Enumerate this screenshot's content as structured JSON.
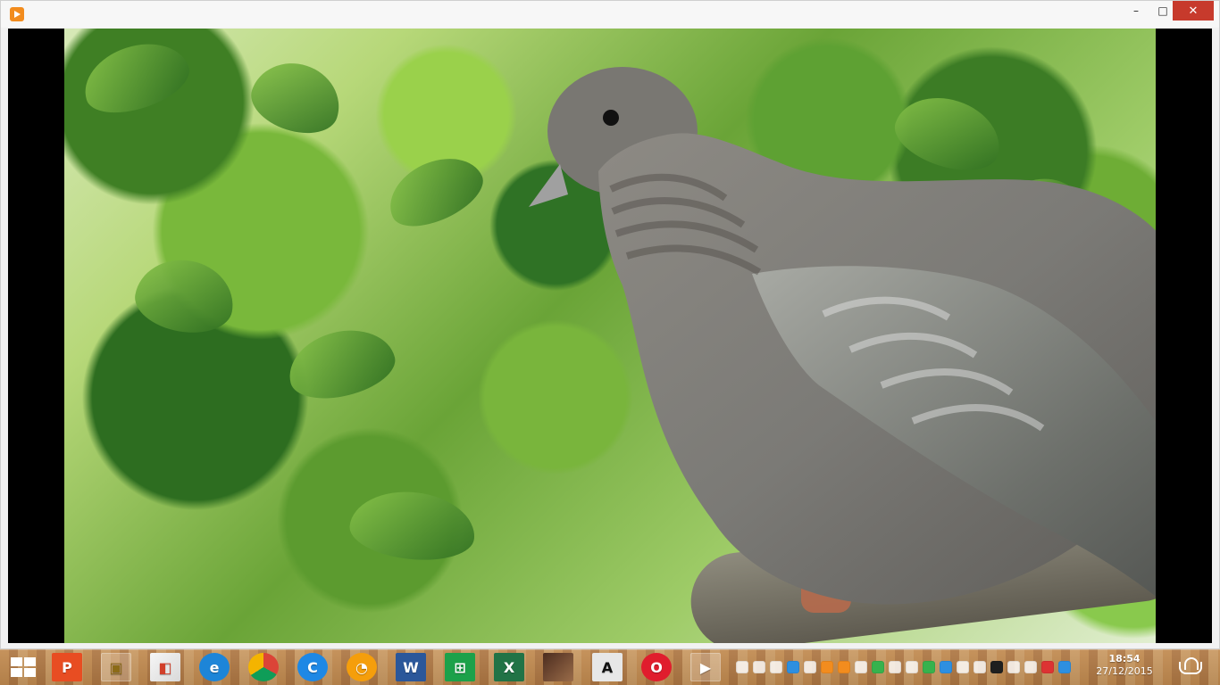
{
  "window": {
    "app_icon": "media-player-icon",
    "buttons": {
      "minimize": "–",
      "maximize": "□",
      "close": "✕"
    }
  },
  "video": {
    "subject": "dove-on-branch",
    "colors": {
      "background": "#000000",
      "leaf_green": "#6aa437",
      "bird_gray": "#7b7a76",
      "branch": "#6c675b"
    }
  },
  "taskbar": {
    "apps": [
      {
        "name": "powerpoint-icon",
        "label": "P"
      },
      {
        "name": "folder-icon",
        "label": "▣"
      },
      {
        "name": "paint-icon",
        "label": "◧"
      },
      {
        "name": "internet-explorer-icon",
        "label": "e"
      },
      {
        "name": "chrome-icon",
        "label": ""
      },
      {
        "name": "c-app-icon",
        "label": "C"
      },
      {
        "name": "firefox-icon",
        "label": "◔"
      },
      {
        "name": "word-icon",
        "label": "W"
      },
      {
        "name": "store-icon",
        "label": "⊞"
      },
      {
        "name": "excel-icon",
        "label": "X"
      },
      {
        "name": "game-icon",
        "label": ""
      },
      {
        "name": "a-app-icon",
        "label": "A"
      },
      {
        "name": "opera-icon",
        "label": "O"
      },
      {
        "name": "media-player-icon",
        "label": "▶"
      }
    ],
    "clock": {
      "time": "18:54",
      "date": "27/12/2015"
    }
  }
}
